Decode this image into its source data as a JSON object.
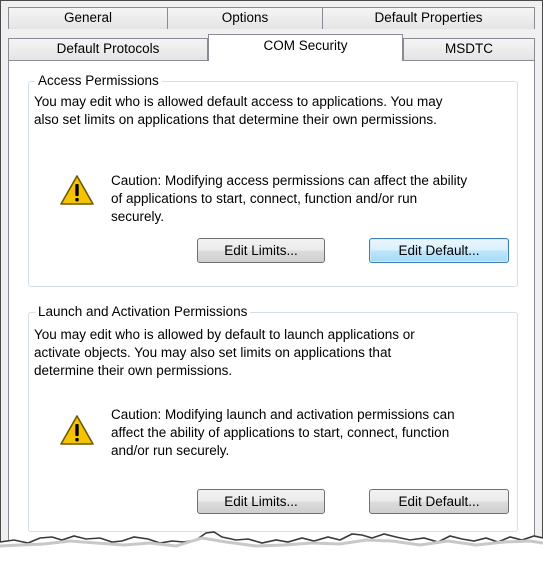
{
  "tabs_row1": [
    "General",
    "Options",
    "Default Properties"
  ],
  "tabs_row2": [
    "Default Protocols",
    "COM Security",
    "MSDTC"
  ],
  "active_tab": "COM Security",
  "access": {
    "title": "Access Permissions",
    "line1": "You may edit who is allowed default access to applications. You may",
    "line2": "also set limits on applications that determine their own permissions.",
    "caution1": "Caution: Modifying access permissions can affect the ability",
    "caution2": "of applications to start, connect, function and/or run",
    "caution3": "securely.",
    "edit_limits": "Edit Limits...",
    "edit_default": "Edit Default..."
  },
  "launch": {
    "title": "Launch and Activation Permissions",
    "line1": "You may edit who is allowed by default to launch applications or",
    "line2": "activate objects. You may also set limits on applications that",
    "line3": "determine their own permissions.",
    "caution1": "Caution: Modifying launch and activation permissions can",
    "caution2": "affect the ability of applications to start, connect, function",
    "caution3": "and/or run securely.",
    "edit_limits": "Edit Limits...",
    "edit_default": "Edit Default..."
  },
  "icons": {
    "warning": "warning-icon"
  },
  "colors": {
    "warning_fill": "#f5c400",
    "focus_border": "#3c7fb1"
  }
}
